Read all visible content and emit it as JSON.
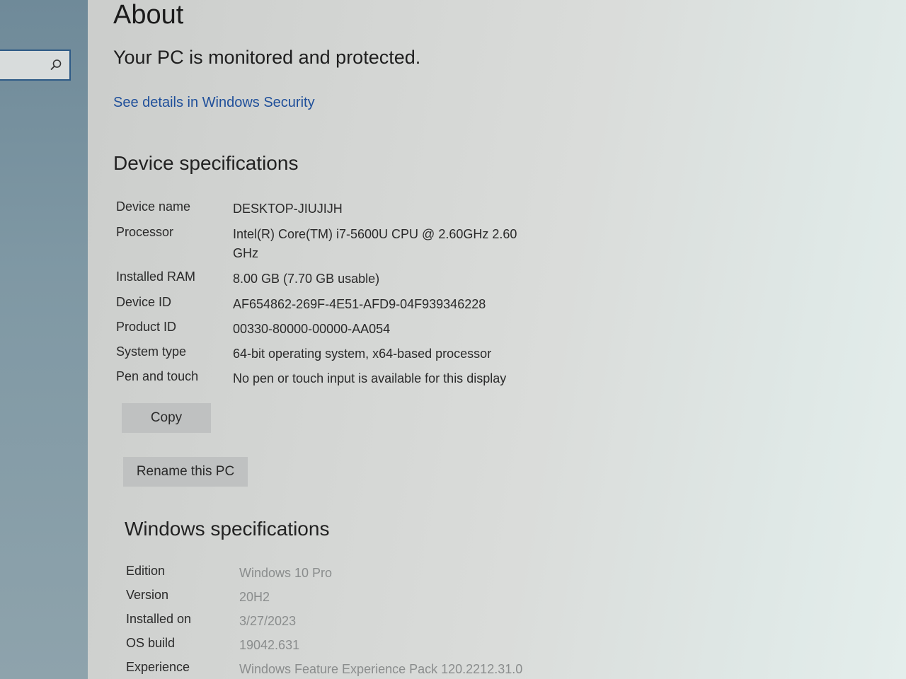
{
  "page": {
    "title": "About",
    "status": "Your PC is monitored and protected.",
    "security_link": "See details in Windows Security"
  },
  "device_specs": {
    "heading": "Device specifications",
    "rows": [
      {
        "label": "Device name",
        "value": "DESKTOP-JIUJIJH"
      },
      {
        "label": "Processor",
        "value": "Intel(R) Core(TM) i7-5600U CPU @ 2.60GHz   2.60 GHz"
      },
      {
        "label": "Installed RAM",
        "value": "8.00 GB (7.70 GB usable)"
      },
      {
        "label": "Device ID",
        "value": "AF654862-269F-4E51-AFD9-04F939346228"
      },
      {
        "label": "Product ID",
        "value": "00330-80000-00000-AA054"
      },
      {
        "label": "System type",
        "value": "64-bit operating system, x64-based processor"
      },
      {
        "label": "Pen and touch",
        "value": "No pen or touch input is available for this display"
      }
    ],
    "copy_button": "Copy",
    "rename_button": "Rename this PC"
  },
  "windows_specs": {
    "heading": "Windows specifications",
    "rows": [
      {
        "label": "Edition",
        "value": "Windows 10 Pro"
      },
      {
        "label": "Version",
        "value": "20H2"
      },
      {
        "label": "Installed on",
        "value": "3/27/2023"
      },
      {
        "label": "OS build",
        "value": "19042.631"
      },
      {
        "label": "Experience",
        "value": "Windows Feature Experience Pack 120.2212.31.0"
      }
    ]
  },
  "colors": {
    "link": "#1f4f9a",
    "search_border": "#2d5a86",
    "sidebar": "#7f98a4"
  },
  "icons": {
    "search": "search-icon"
  }
}
